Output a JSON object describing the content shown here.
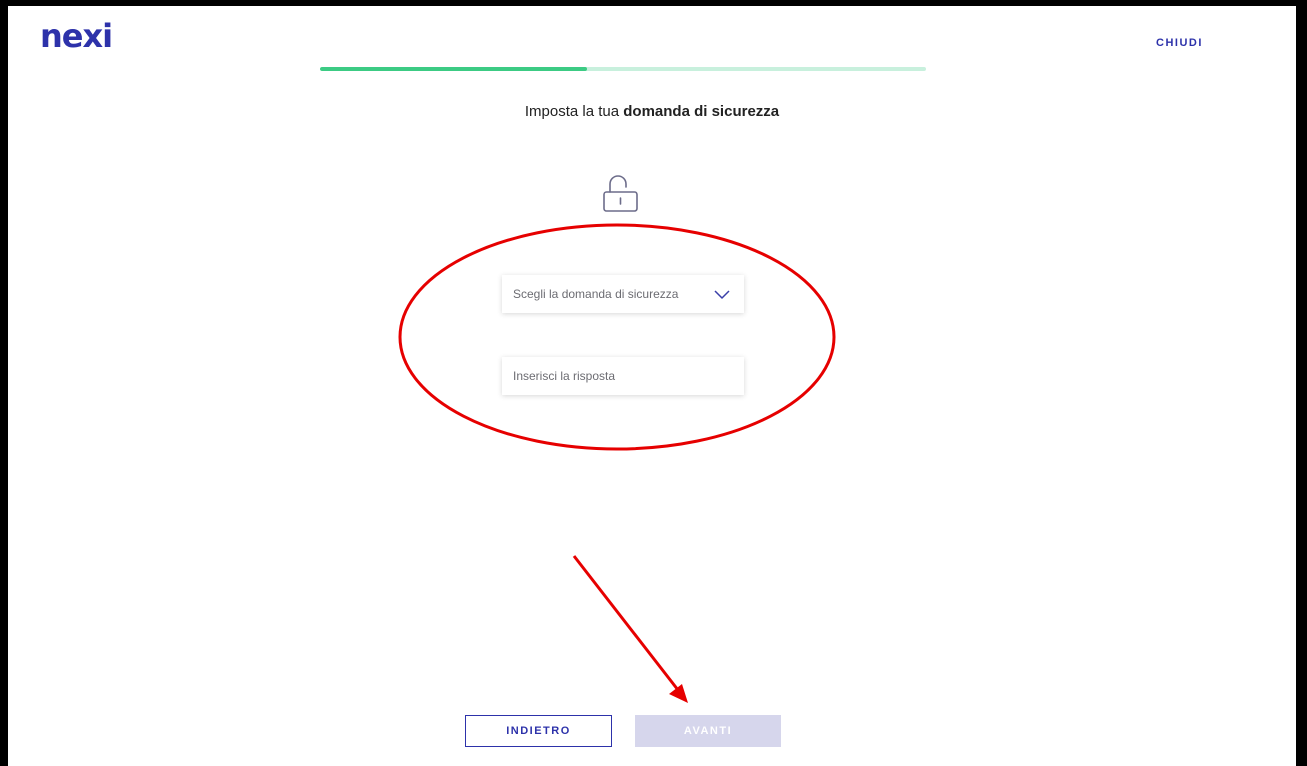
{
  "header": {
    "logo_text": "nexi",
    "close_label": "CHIUDI"
  },
  "progress": {
    "fraction": 0.44
  },
  "title": {
    "prefix": "Imposta la tua ",
    "emphasis": "domanda di sicurezza"
  },
  "form": {
    "question_select_label": "Scegli la domanda di sicurezza",
    "answer_placeholder": "Inserisci la risposta",
    "answer_value": ""
  },
  "footer": {
    "back_label": "INDIETRO",
    "next_label": "AVANTI"
  },
  "icons": {
    "lock": "lock-open-icon",
    "dropdown": "chevron-down-icon"
  },
  "colors": {
    "brand": "#2d32aa",
    "progress": "#3ccb84",
    "progress_track": "#c8f0dd",
    "disabled_button": "#d6d6ec",
    "annotation": "#e60000"
  }
}
